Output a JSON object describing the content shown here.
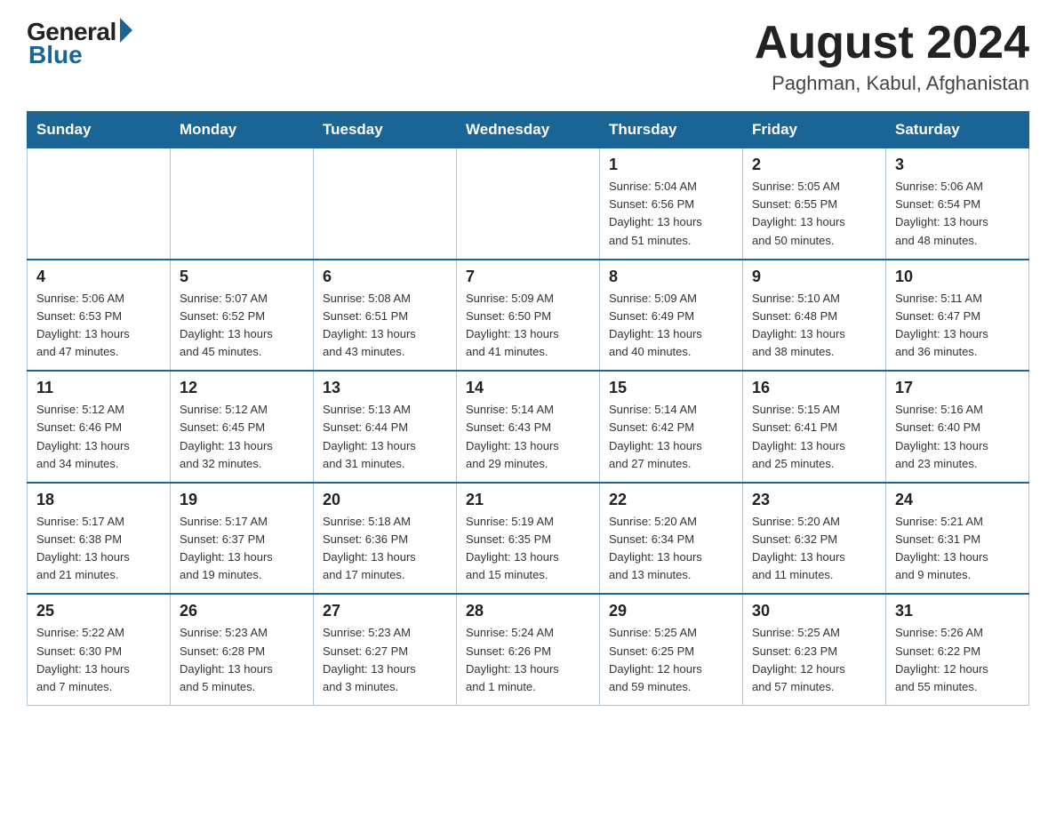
{
  "header": {
    "logo_general": "General",
    "logo_blue": "Blue",
    "month_title": "August 2024",
    "location": "Paghman, Kabul, Afghanistan"
  },
  "weekdays": [
    "Sunday",
    "Monday",
    "Tuesday",
    "Wednesday",
    "Thursday",
    "Friday",
    "Saturday"
  ],
  "weeks": [
    [
      {
        "day": "",
        "info": ""
      },
      {
        "day": "",
        "info": ""
      },
      {
        "day": "",
        "info": ""
      },
      {
        "day": "",
        "info": ""
      },
      {
        "day": "1",
        "info": "Sunrise: 5:04 AM\nSunset: 6:56 PM\nDaylight: 13 hours\nand 51 minutes."
      },
      {
        "day": "2",
        "info": "Sunrise: 5:05 AM\nSunset: 6:55 PM\nDaylight: 13 hours\nand 50 minutes."
      },
      {
        "day": "3",
        "info": "Sunrise: 5:06 AM\nSunset: 6:54 PM\nDaylight: 13 hours\nand 48 minutes."
      }
    ],
    [
      {
        "day": "4",
        "info": "Sunrise: 5:06 AM\nSunset: 6:53 PM\nDaylight: 13 hours\nand 47 minutes."
      },
      {
        "day": "5",
        "info": "Sunrise: 5:07 AM\nSunset: 6:52 PM\nDaylight: 13 hours\nand 45 minutes."
      },
      {
        "day": "6",
        "info": "Sunrise: 5:08 AM\nSunset: 6:51 PM\nDaylight: 13 hours\nand 43 minutes."
      },
      {
        "day": "7",
        "info": "Sunrise: 5:09 AM\nSunset: 6:50 PM\nDaylight: 13 hours\nand 41 minutes."
      },
      {
        "day": "8",
        "info": "Sunrise: 5:09 AM\nSunset: 6:49 PM\nDaylight: 13 hours\nand 40 minutes."
      },
      {
        "day": "9",
        "info": "Sunrise: 5:10 AM\nSunset: 6:48 PM\nDaylight: 13 hours\nand 38 minutes."
      },
      {
        "day": "10",
        "info": "Sunrise: 5:11 AM\nSunset: 6:47 PM\nDaylight: 13 hours\nand 36 minutes."
      }
    ],
    [
      {
        "day": "11",
        "info": "Sunrise: 5:12 AM\nSunset: 6:46 PM\nDaylight: 13 hours\nand 34 minutes."
      },
      {
        "day": "12",
        "info": "Sunrise: 5:12 AM\nSunset: 6:45 PM\nDaylight: 13 hours\nand 32 minutes."
      },
      {
        "day": "13",
        "info": "Sunrise: 5:13 AM\nSunset: 6:44 PM\nDaylight: 13 hours\nand 31 minutes."
      },
      {
        "day": "14",
        "info": "Sunrise: 5:14 AM\nSunset: 6:43 PM\nDaylight: 13 hours\nand 29 minutes."
      },
      {
        "day": "15",
        "info": "Sunrise: 5:14 AM\nSunset: 6:42 PM\nDaylight: 13 hours\nand 27 minutes."
      },
      {
        "day": "16",
        "info": "Sunrise: 5:15 AM\nSunset: 6:41 PM\nDaylight: 13 hours\nand 25 minutes."
      },
      {
        "day": "17",
        "info": "Sunrise: 5:16 AM\nSunset: 6:40 PM\nDaylight: 13 hours\nand 23 minutes."
      }
    ],
    [
      {
        "day": "18",
        "info": "Sunrise: 5:17 AM\nSunset: 6:38 PM\nDaylight: 13 hours\nand 21 minutes."
      },
      {
        "day": "19",
        "info": "Sunrise: 5:17 AM\nSunset: 6:37 PM\nDaylight: 13 hours\nand 19 minutes."
      },
      {
        "day": "20",
        "info": "Sunrise: 5:18 AM\nSunset: 6:36 PM\nDaylight: 13 hours\nand 17 minutes."
      },
      {
        "day": "21",
        "info": "Sunrise: 5:19 AM\nSunset: 6:35 PM\nDaylight: 13 hours\nand 15 minutes."
      },
      {
        "day": "22",
        "info": "Sunrise: 5:20 AM\nSunset: 6:34 PM\nDaylight: 13 hours\nand 13 minutes."
      },
      {
        "day": "23",
        "info": "Sunrise: 5:20 AM\nSunset: 6:32 PM\nDaylight: 13 hours\nand 11 minutes."
      },
      {
        "day": "24",
        "info": "Sunrise: 5:21 AM\nSunset: 6:31 PM\nDaylight: 13 hours\nand 9 minutes."
      }
    ],
    [
      {
        "day": "25",
        "info": "Sunrise: 5:22 AM\nSunset: 6:30 PM\nDaylight: 13 hours\nand 7 minutes."
      },
      {
        "day": "26",
        "info": "Sunrise: 5:23 AM\nSunset: 6:28 PM\nDaylight: 13 hours\nand 5 minutes."
      },
      {
        "day": "27",
        "info": "Sunrise: 5:23 AM\nSunset: 6:27 PM\nDaylight: 13 hours\nand 3 minutes."
      },
      {
        "day": "28",
        "info": "Sunrise: 5:24 AM\nSunset: 6:26 PM\nDaylight: 13 hours\nand 1 minute."
      },
      {
        "day": "29",
        "info": "Sunrise: 5:25 AM\nSunset: 6:25 PM\nDaylight: 12 hours\nand 59 minutes."
      },
      {
        "day": "30",
        "info": "Sunrise: 5:25 AM\nSunset: 6:23 PM\nDaylight: 12 hours\nand 57 minutes."
      },
      {
        "day": "31",
        "info": "Sunrise: 5:26 AM\nSunset: 6:22 PM\nDaylight: 12 hours\nand 55 minutes."
      }
    ]
  ]
}
